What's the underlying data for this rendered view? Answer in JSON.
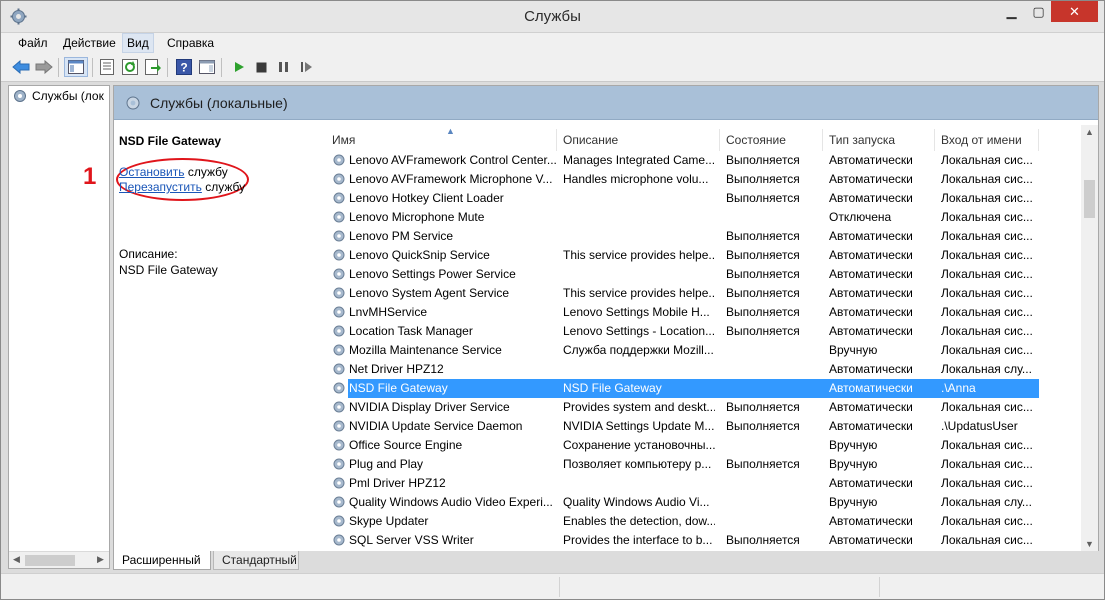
{
  "window": {
    "title": "Службы"
  },
  "menu": [
    "Файл",
    "Действие",
    "Вид",
    "Справка"
  ],
  "tree": {
    "root_label": "Службы (лок"
  },
  "panel": {
    "header_title": "Службы (локальные)"
  },
  "extended": {
    "service_name": "NSD File Gateway",
    "stop_link": "Остановить",
    "stop_suffix": " службу",
    "restart_link": "Перезапустить",
    "restart_suffix": " службу",
    "description_label": "Описание:",
    "description_value": "NSD File Gateway",
    "annotation_marker": "1",
    "annotation_color": "#e0151b"
  },
  "columns": [
    "Имя",
    "Описание",
    "Состояние",
    "Тип запуска",
    "Вход от имени"
  ],
  "services": [
    {
      "name": "Lenovo AVFramework Control Center...",
      "desc": "Manages Integrated Came...",
      "state": "Выполняется",
      "start": "Автоматически",
      "logon": "Локальная сис..."
    },
    {
      "name": "Lenovo AVFramework Microphone V...",
      "desc": "Handles microphone volu...",
      "state": "Выполняется",
      "start": "Автоматически",
      "logon": "Локальная сис..."
    },
    {
      "name": "Lenovo Hotkey Client Loader",
      "desc": "",
      "state": "Выполняется",
      "start": "Автоматически",
      "logon": "Локальная сис..."
    },
    {
      "name": "Lenovo Microphone Mute",
      "desc": "",
      "state": "",
      "start": "Отключена",
      "logon": "Локальная сис..."
    },
    {
      "name": "Lenovo PM Service",
      "desc": "",
      "state": "Выполняется",
      "start": "Автоматически",
      "logon": "Локальная сис..."
    },
    {
      "name": "Lenovo QuickSnip Service",
      "desc": "This service provides helpe...",
      "state": "Выполняется",
      "start": "Автоматически",
      "logon": "Локальная сис..."
    },
    {
      "name": "Lenovo Settings Power Service",
      "desc": "",
      "state": "Выполняется",
      "start": "Автоматически",
      "logon": "Локальная сис..."
    },
    {
      "name": "Lenovo System Agent Service",
      "desc": "This service provides helpe...",
      "state": "Выполняется",
      "start": "Автоматически",
      "logon": "Локальная сис..."
    },
    {
      "name": "LnvMHService",
      "desc": "Lenovo Settings Mobile H...",
      "state": "Выполняется",
      "start": "Автоматически",
      "logon": "Локальная сис..."
    },
    {
      "name": "Location Task Manager",
      "desc": "Lenovo Settings - Location...",
      "state": "Выполняется",
      "start": "Автоматически",
      "logon": "Локальная сис..."
    },
    {
      "name": "Mozilla Maintenance Service",
      "desc": "Служба поддержки Mozill...",
      "state": "",
      "start": "Вручную",
      "logon": "Локальная сис..."
    },
    {
      "name": "Net Driver HPZ12",
      "desc": "",
      "state": "",
      "start": "Автоматически",
      "logon": "Локальная слу..."
    },
    {
      "name": "NSD File Gateway",
      "desc": "NSD File Gateway",
      "state": "",
      "start": "Автоматически",
      "logon": ".\\Anna",
      "selected": true
    },
    {
      "name": "NVIDIA Display Driver Service",
      "desc": "Provides system and deskt...",
      "state": "Выполняется",
      "start": "Автоматически",
      "logon": "Локальная сис..."
    },
    {
      "name": "NVIDIA Update Service Daemon",
      "desc": "NVIDIA Settings Update M...",
      "state": "Выполняется",
      "start": "Автоматически",
      "logon": ".\\UpdatusUser"
    },
    {
      "name": "Office  Source Engine",
      "desc": "Сохранение установочны...",
      "state": "",
      "start": "Вручную",
      "logon": "Локальная сис..."
    },
    {
      "name": "Plug and Play",
      "desc": "Позволяет компьютеру р...",
      "state": "Выполняется",
      "start": "Вручную",
      "logon": "Локальная сис..."
    },
    {
      "name": "Pml Driver HPZ12",
      "desc": "",
      "state": "",
      "start": "Автоматически",
      "logon": "Локальная сис..."
    },
    {
      "name": "Quality Windows Audio Video Experi...",
      "desc": "Quality Windows Audio Vi...",
      "state": "",
      "start": "Вручную",
      "logon": "Локальная слу..."
    },
    {
      "name": "Skype Updater",
      "desc": "Enables the detection, dow...",
      "state": "",
      "start": "Автоматически",
      "logon": "Локальная сис..."
    },
    {
      "name": "SQL Server VSS Writer",
      "desc": "Provides the interface to b...",
      "state": "Выполняется",
      "start": "Автоматически",
      "logon": "Локальная сис..."
    }
  ],
  "tabs": [
    "Расширенный",
    "Стандартный"
  ],
  "colors": {
    "header_band": "#a9c0d8",
    "selection": "#3399ff",
    "link": "#1a56b8",
    "close_button": "#c7352b"
  }
}
